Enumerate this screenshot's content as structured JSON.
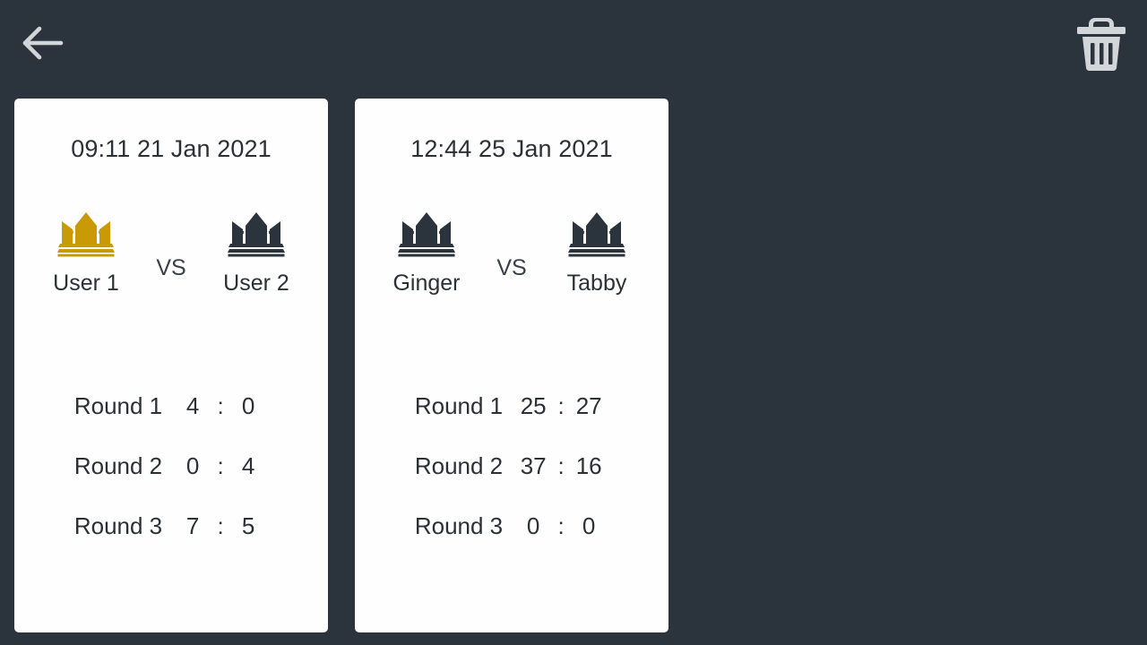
{
  "theme": {
    "background": "#2b333c",
    "card_background": "#fefefe",
    "text_dark": "#2b3036",
    "crown_gold": "#c99a06",
    "crown_dark": "#2b333c",
    "icon_light": "#d3d6d8"
  },
  "topbar": {
    "back_icon": "arrow-left-icon",
    "delete_icon": "trash-icon"
  },
  "matches": [
    {
      "date": "09:11 21 Jan 2021",
      "vs_label": "VS",
      "player1": {
        "name": "User 1",
        "crown": "crown-icon",
        "crown_color": "gold"
      },
      "player2": {
        "name": "User 2",
        "crown": "crown-icon",
        "crown_color": "dark"
      },
      "rounds": [
        {
          "label": "Round 1",
          "score1": "4",
          "colon": ":",
          "score2": "0"
        },
        {
          "label": "Round 2",
          "score1": "0",
          "colon": ":",
          "score2": "4"
        },
        {
          "label": "Round 3",
          "score1": "7",
          "colon": ":",
          "score2": "5"
        }
      ]
    },
    {
      "date": "12:44 25 Jan 2021",
      "vs_label": "VS",
      "player1": {
        "name": "Ginger",
        "crown": "crown-icon",
        "crown_color": "dark"
      },
      "player2": {
        "name": "Tabby",
        "crown": "crown-icon",
        "crown_color": "dark"
      },
      "rounds": [
        {
          "label": "Round 1",
          "score1": "25",
          "colon": ":",
          "score2": "27"
        },
        {
          "label": "Round 2",
          "score1": "37",
          "colon": ":",
          "score2": "16"
        },
        {
          "label": "Round 3",
          "score1": "0",
          "colon": ":",
          "score2": "0"
        }
      ]
    }
  ]
}
